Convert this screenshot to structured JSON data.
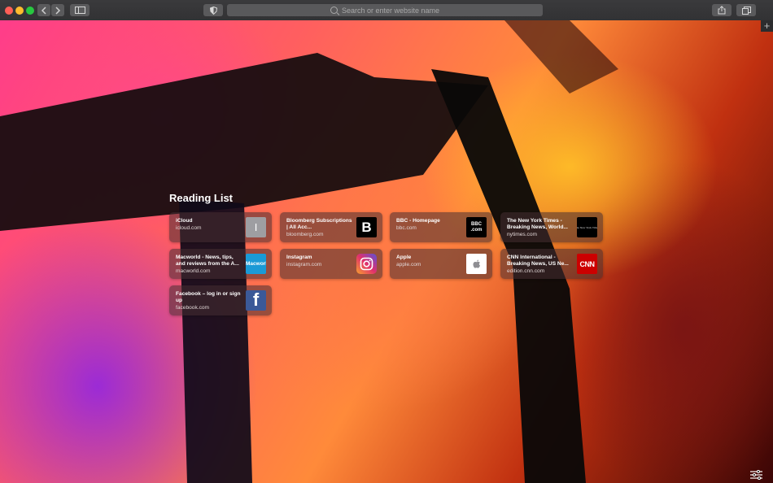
{
  "toolbar": {
    "search_placeholder": "Search or enter website name",
    "new_tab_label": "+"
  },
  "reading_list": {
    "title": "Reading List",
    "items": [
      {
        "title": "iCloud",
        "url": "icloud.com",
        "icon": "icloud-letter-icon",
        "icon_text": "I",
        "icon_bg": "#9e9ea2"
      },
      {
        "title": "Bloomberg Subscriptions | All Acc...",
        "url": "bloomberg.com",
        "icon": "bloomberg-logo-icon",
        "icon_text": "B",
        "icon_bg": "#000000"
      },
      {
        "title": "BBC - Homepage",
        "url": "bbc.com",
        "icon": "bbc-logo-icon",
        "icon_text": "BBC .com",
        "icon_bg": "#000000"
      },
      {
        "title": "The New York Times - Breaking News, World...",
        "url": "nytimes.com",
        "icon": "nytimes-logo-icon",
        "icon_text": "The New York Times",
        "icon_bg": "#000000"
      },
      {
        "title": "Macworld - News, tips, and reviews from the A...",
        "url": "macworld.com",
        "icon": "macworld-logo-icon",
        "icon_text": "Macworld",
        "icon_bg": "#1a9ad6"
      },
      {
        "title": "Instagram",
        "url": "instagram.com",
        "icon": "instagram-logo-icon",
        "icon_text": "",
        "icon_bg": "#c13584"
      },
      {
        "title": "Apple",
        "url": "apple.com",
        "icon": "apple-logo-icon",
        "icon_text": "",
        "icon_bg": "#ffffff"
      },
      {
        "title": "CNN International - Breaking News, US Ne...",
        "url": "edition.cnn.com",
        "icon": "cnn-logo-icon",
        "icon_text": "CNN",
        "icon_bg": "#cc0000"
      },
      {
        "title": "Facebook – log in or sign up",
        "url": "facebook.com",
        "icon": "facebook-logo-icon",
        "icon_text": "f",
        "icon_bg": "#3b5998"
      }
    ]
  },
  "colors": {
    "toolbar_bg": "#333335",
    "close": "#ff5f57",
    "minimize": "#febc2e",
    "zoom": "#28c840",
    "card_bg": "rgba(70,45,50,0.55)"
  }
}
